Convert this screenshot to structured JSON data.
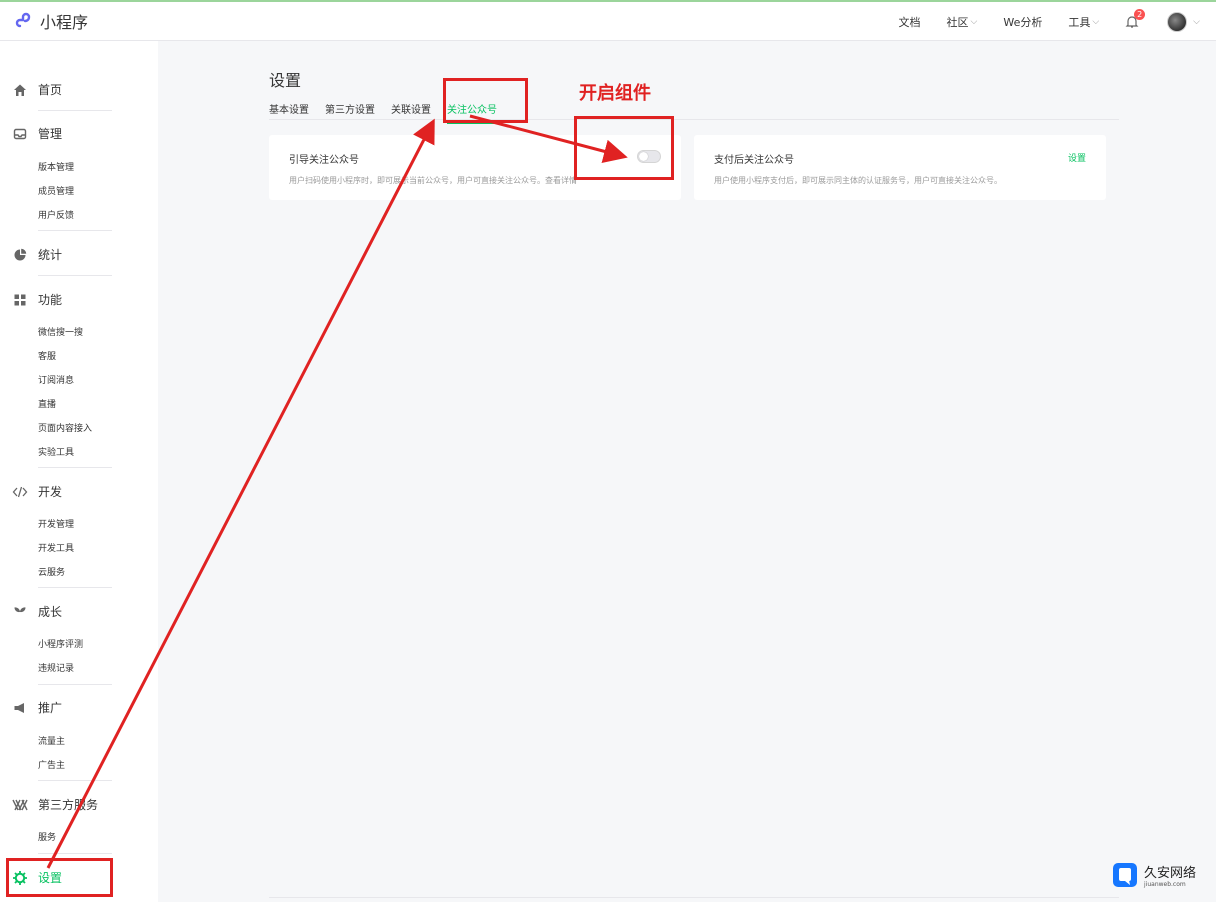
{
  "app": {
    "name": "小程序"
  },
  "topnav": {
    "docs": "文档",
    "community": "社区",
    "weanalysis": "We分析",
    "tools": "工具",
    "notifications": "2"
  },
  "sidebar": {
    "home": "首页",
    "manage": {
      "label": "管理",
      "items": [
        "版本管理",
        "成员管理",
        "用户反馈"
      ]
    },
    "stats": "统计",
    "features": {
      "label": "功能",
      "items": [
        "微信搜一搜",
        "客服",
        "订阅消息",
        "直播",
        "页面内容接入",
        "实验工具"
      ]
    },
    "dev": {
      "label": "开发",
      "items": [
        "开发管理",
        "开发工具",
        "云服务"
      ]
    },
    "growth": {
      "label": "成长",
      "items": [
        "小程序评测",
        "违规记录"
      ]
    },
    "promote": {
      "label": "推广",
      "items": [
        "流量主",
        "广告主"
      ]
    },
    "thirdparty": {
      "label": "第三方服务",
      "items": [
        "服务"
      ]
    },
    "settings": "设置"
  },
  "main": {
    "title": "设置",
    "tabs": [
      "基本设置",
      "第三方设置",
      "关联设置",
      "关注公众号"
    ],
    "cards": [
      {
        "title": "引导关注公众号",
        "desc": "用户扫码使用小程序时，即可展示当前公众号，用户可直接关注公众号。查看详情"
      },
      {
        "title": "支付后关注公众号",
        "desc": "用户使用小程序支付后，即可展示同主体的认证服务号，用户可直接关注公众号。",
        "action": "设置"
      }
    ]
  },
  "annotation": {
    "label": "开启组件",
    "color": "#e02222"
  },
  "watermark": {
    "name": "久安网络",
    "url": "jiuanweb.com"
  },
  "colors": {
    "accent": "#07c160",
    "annotation": "#e02222",
    "badge": "#fa5151"
  }
}
